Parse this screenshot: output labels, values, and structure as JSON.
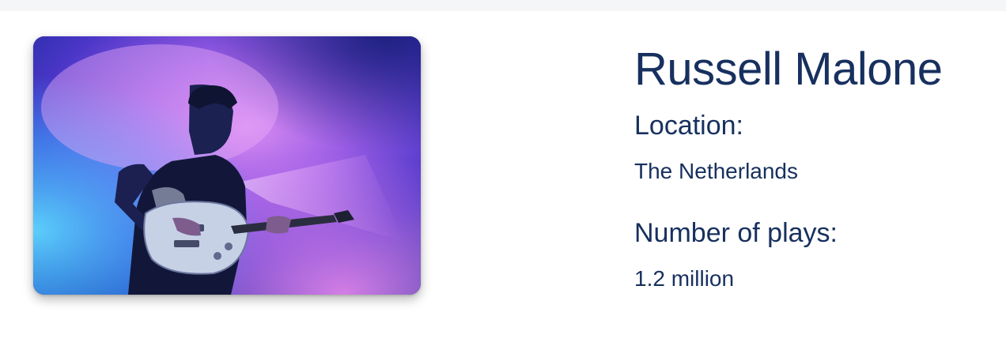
{
  "artist": {
    "name": "Russell Malone",
    "photo_alt": "Guitarist performing on stage in blue and purple light"
  },
  "details": {
    "location_label": "Location:",
    "location_value": "The Netherlands",
    "plays_label": "Number of plays:",
    "plays_value": "1.2 million"
  },
  "colors": {
    "text_primary": "#17305f",
    "background": "#ffffff",
    "top_strip": "#f5f6f8"
  }
}
